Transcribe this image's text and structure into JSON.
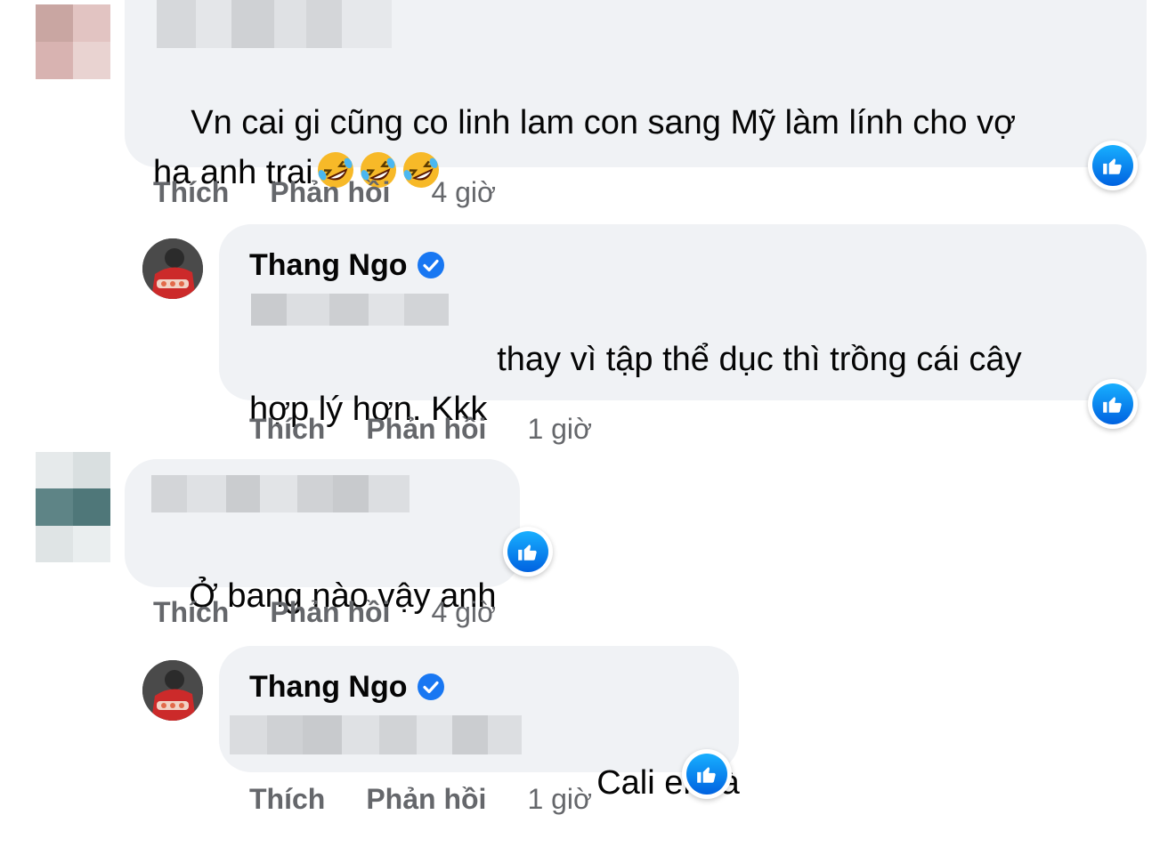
{
  "colors": {
    "bubble": "#f0f2f5",
    "meta_text": "#65676b",
    "like_blue": "#1877f2",
    "verified_blue": "#1877f2"
  },
  "comments": [
    {
      "author": "",
      "text_line1": "Vn cai gi cũng co linh lam con sang Mỹ làm lính cho vợ",
      "text_line2": "ha anh trai",
      "emoji": "rolling-on-floor-laughing",
      "actions": {
        "like": "Thích",
        "reply": "Phản hồi",
        "time": "4 giờ"
      }
    },
    {
      "author": "Thang Ngo",
      "verified": true,
      "text_line1": "thay vì tập thể dục thì trồng cái cây",
      "text_line2": "hợp lý hơn. Kkk",
      "actions": {
        "like": "Thích",
        "reply": "Phản hồi",
        "time": "1 giờ"
      }
    },
    {
      "author": "",
      "text_line1": "Ở bang nào vậy anh",
      "actions": {
        "like": "Thích",
        "reply": "Phản hồi",
        "time": "4 giờ"
      }
    },
    {
      "author": "Thang Ngo",
      "verified": true,
      "text_line1": "Cali em à",
      "actions": {
        "like": "Thích",
        "reply": "Phản hồi",
        "time": "1 giờ"
      }
    }
  ]
}
